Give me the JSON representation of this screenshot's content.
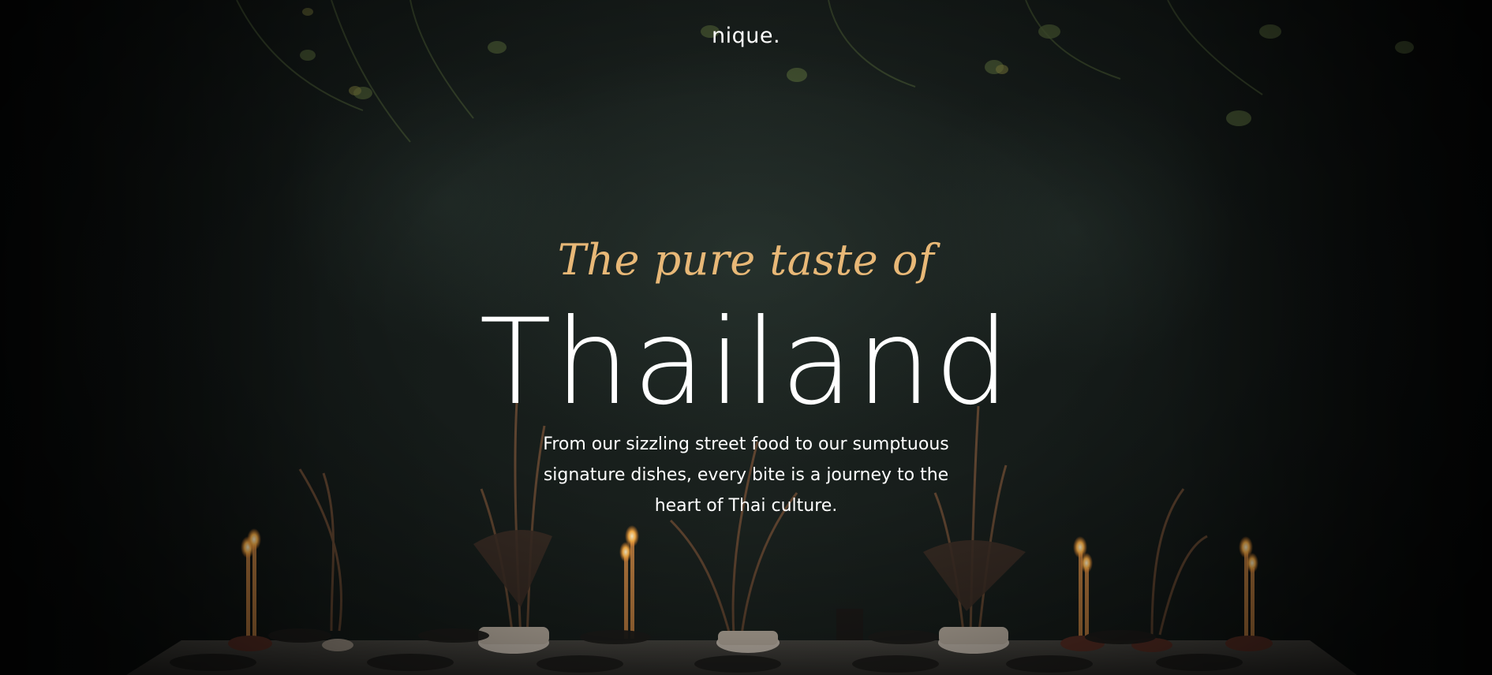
{
  "brand": {
    "logo_text": "nique."
  },
  "hero": {
    "tagline": "The pure taste of",
    "title": "Thailand",
    "description": "From our sizzling street food to our sumptuous signature dishes, every bite is a journey to the heart of Thai culture."
  },
  "colors": {
    "accent": "#e8b877",
    "text": "#ffffff",
    "background": "#141a18"
  }
}
